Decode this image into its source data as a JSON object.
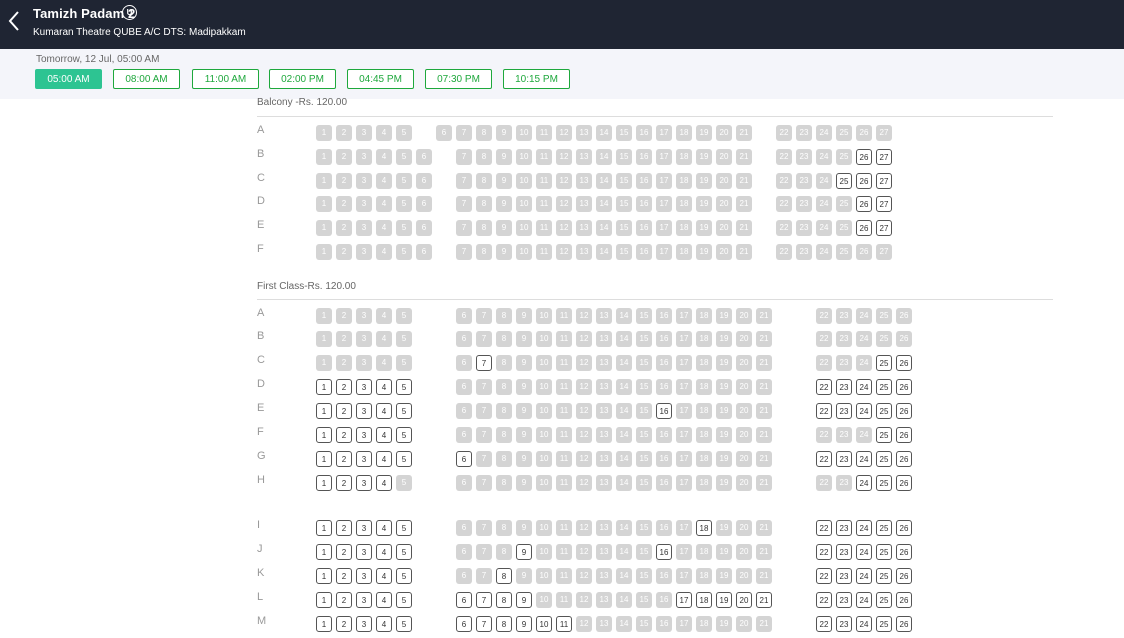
{
  "header": {
    "movie_title": "Tamizh Padam 2",
    "certificate": "U",
    "theatre": "Kumaran Theatre QUBE A/C DTS: Madipakkam"
  },
  "showtimes": {
    "date_label": "Tomorrow, 12 Jul, 05:00 AM",
    "selected": "05:00 AM",
    "times": [
      "05:00 AM",
      "08:00 AM",
      "11:00 AM",
      "02:00 PM",
      "04:45 PM",
      "07:30 PM",
      "10:15 PM"
    ]
  },
  "colors": {
    "header_bg": "#1f2533",
    "accent": "#2dc492",
    "sold_seat": "#d4d4d4"
  },
  "sections": [
    {
      "name": "Balcony -Rs. 120.00",
      "rows": [
        {
          "label": "A",
          "blocks": [
            [
              1,
              2,
              3,
              4,
              5
            ],
            [
              6,
              7,
              8,
              9,
              10,
              11,
              12,
              13,
              14,
              15,
              16,
              17,
              18,
              19,
              20,
              21
            ],
            [
              22,
              23,
              24,
              25,
              26,
              27
            ]
          ],
          "available": []
        },
        {
          "label": "B",
          "blocks": [
            [
              1,
              2,
              3,
              4,
              5,
              6
            ],
            [
              7,
              8,
              9,
              10,
              11,
              12,
              13,
              14,
              15,
              16,
              17,
              18,
              19,
              20,
              21
            ],
            [
              22,
              23,
              24,
              25,
              26,
              27
            ]
          ],
          "available": [
            26,
            27
          ]
        },
        {
          "label": "C",
          "blocks": [
            [
              1,
              2,
              3,
              4,
              5,
              6
            ],
            [
              7,
              8,
              9,
              10,
              11,
              12,
              13,
              14,
              15,
              16,
              17,
              18,
              19,
              20,
              21
            ],
            [
              22,
              23,
              24,
              25,
              26,
              27
            ]
          ],
          "available": [
            25,
            26,
            27
          ]
        },
        {
          "label": "D",
          "blocks": [
            [
              1,
              2,
              3,
              4,
              5,
              6
            ],
            [
              7,
              8,
              9,
              10,
              11,
              12,
              13,
              14,
              15,
              16,
              17,
              18,
              19,
              20,
              21
            ],
            [
              22,
              23,
              24,
              25,
              26,
              27
            ]
          ],
          "available": [
            26,
            27
          ]
        },
        {
          "label": "E",
          "blocks": [
            [
              1,
              2,
              3,
              4,
              5,
              6
            ],
            [
              7,
              8,
              9,
              10,
              11,
              12,
              13,
              14,
              15,
              16,
              17,
              18,
              19,
              20,
              21
            ],
            [
              22,
              23,
              24,
              25,
              26,
              27
            ]
          ],
          "available": [
            26,
            27
          ]
        },
        {
          "label": "F",
          "blocks": [
            [
              1,
              2,
              3,
              4,
              5,
              6
            ],
            [
              7,
              8,
              9,
              10,
              11,
              12,
              13,
              14,
              15,
              16,
              17,
              18,
              19,
              20,
              21
            ],
            [
              22,
              23,
              24,
              25,
              26,
              27
            ]
          ],
          "available": []
        }
      ]
    },
    {
      "name": "First Class-Rs. 120.00",
      "rows": [
        {
          "label": "A",
          "blocks": [
            [
              1,
              2,
              3,
              4,
              5
            ],
            [
              6,
              7,
              8,
              9,
              10,
              11,
              12,
              13,
              14,
              15,
              16,
              17,
              18,
              19,
              20,
              21
            ],
            [
              22,
              23,
              24,
              25,
              26
            ]
          ],
          "available": []
        },
        {
          "label": "B",
          "blocks": [
            [
              1,
              2,
              3,
              4,
              5
            ],
            [
              6,
              7,
              8,
              9,
              10,
              11,
              12,
              13,
              14,
              15,
              16,
              17,
              18,
              19,
              20,
              21
            ],
            [
              22,
              23,
              24,
              25,
              26
            ]
          ],
          "available": []
        },
        {
          "label": "C",
          "blocks": [
            [
              1,
              2,
              3,
              4,
              5
            ],
            [
              6,
              7,
              8,
              9,
              10,
              11,
              12,
              13,
              14,
              15,
              16,
              17,
              18,
              19,
              20,
              21
            ],
            [
              22,
              23,
              24,
              25,
              26
            ]
          ],
          "available": [
            7,
            25,
            26
          ]
        },
        {
          "label": "D",
          "blocks": [
            [
              1,
              2,
              3,
              4,
              5
            ],
            [
              6,
              7,
              8,
              9,
              10,
              11,
              12,
              13,
              14,
              15,
              16,
              17,
              18,
              19,
              20,
              21
            ],
            [
              22,
              23,
              24,
              25,
              26
            ]
          ],
          "available": [
            1,
            2,
            3,
            4,
            5,
            22,
            23,
            24,
            25,
            26
          ]
        },
        {
          "label": "E",
          "blocks": [
            [
              1,
              2,
              3,
              4,
              5
            ],
            [
              6,
              7,
              8,
              9,
              10,
              11,
              12,
              13,
              14,
              15,
              16,
              17,
              18,
              19,
              20,
              21
            ],
            [
              22,
              23,
              24,
              25,
              26
            ]
          ],
          "available": [
            1,
            2,
            3,
            4,
            5,
            16,
            22,
            23,
            24,
            25,
            26
          ]
        },
        {
          "label": "F",
          "blocks": [
            [
              1,
              2,
              3,
              4,
              5
            ],
            [
              6,
              7,
              8,
              9,
              10,
              11,
              12,
              13,
              14,
              15,
              16,
              17,
              18,
              19,
              20,
              21
            ],
            [
              22,
              23,
              24,
              25,
              26
            ]
          ],
          "available": [
            1,
            2,
            3,
            4,
            5,
            25,
            26
          ]
        },
        {
          "label": "G",
          "blocks": [
            [
              1,
              2,
              3,
              4,
              5
            ],
            [
              6,
              7,
              8,
              9,
              10,
              11,
              12,
              13,
              14,
              15,
              16,
              17,
              18,
              19,
              20,
              21
            ],
            [
              22,
              23,
              24,
              25,
              26
            ]
          ],
          "available": [
            1,
            2,
            3,
            4,
            5,
            6,
            22,
            23,
            24,
            25,
            26
          ]
        },
        {
          "label": "H",
          "blocks": [
            [
              1,
              2,
              3,
              4,
              5
            ],
            [
              6,
              7,
              8,
              9,
              10,
              11,
              12,
              13,
              14,
              15,
              16,
              17,
              18,
              19,
              20,
              21
            ],
            [
              22,
              23,
              24,
              25,
              26
            ]
          ],
          "available": [
            1,
            2,
            3,
            4,
            24,
            25,
            26
          ]
        },
        {
          "label": "I",
          "blocks": [
            [
              1,
              2,
              3,
              4,
              5
            ],
            [
              6,
              7,
              8,
              9,
              10,
              11,
              12,
              13,
              14,
              15,
              16,
              17,
              18,
              19,
              20,
              21
            ],
            [
              22,
              23,
              24,
              25,
              26
            ]
          ],
          "available": [
            1,
            2,
            3,
            4,
            5,
            18,
            22,
            23,
            24,
            25,
            26
          ]
        },
        {
          "label": "J",
          "blocks": [
            [
              1,
              2,
              3,
              4,
              5
            ],
            [
              6,
              7,
              8,
              9,
              10,
              11,
              12,
              13,
              14,
              15,
              16,
              17,
              18,
              19,
              20,
              21
            ],
            [
              22,
              23,
              24,
              25,
              26
            ]
          ],
          "available": [
            1,
            2,
            3,
            4,
            5,
            9,
            16,
            22,
            23,
            24,
            25,
            26
          ]
        },
        {
          "label": "K",
          "blocks": [
            [
              1,
              2,
              3,
              4,
              5
            ],
            [
              6,
              7,
              8,
              9,
              10,
              11,
              12,
              13,
              14,
              15,
              16,
              17,
              18,
              19,
              20,
              21
            ],
            [
              22,
              23,
              24,
              25,
              26
            ]
          ],
          "available": [
            1,
            2,
            3,
            4,
            5,
            8,
            22,
            23,
            24,
            25,
            26
          ]
        },
        {
          "label": "L",
          "blocks": [
            [
              1,
              2,
              3,
              4,
              5
            ],
            [
              6,
              7,
              8,
              9,
              10,
              11,
              12,
              13,
              14,
              15,
              16,
              17,
              18,
              19,
              20,
              21
            ],
            [
              22,
              23,
              24,
              25,
              26
            ]
          ],
          "available": [
            1,
            2,
            3,
            4,
            5,
            6,
            7,
            8,
            9,
            17,
            18,
            19,
            20,
            21,
            22,
            23,
            24,
            25,
            26
          ]
        },
        {
          "label": "M",
          "blocks": [
            [
              1,
              2,
              3,
              4,
              5
            ],
            [
              6,
              7,
              8,
              9,
              10,
              11,
              12,
              13,
              14,
              15,
              16,
              17,
              18,
              19,
              20,
              21
            ],
            [
              22,
              23,
              24,
              25,
              26
            ]
          ],
          "available": [
            1,
            2,
            3,
            4,
            5,
            6,
            7,
            8,
            9,
            10,
            11,
            22,
            23,
            24,
            25,
            26
          ]
        }
      ]
    }
  ]
}
